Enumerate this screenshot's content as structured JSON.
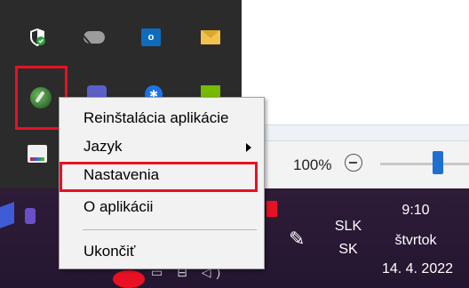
{
  "tray_overflow": {
    "icons": [
      {
        "name": "windows-security-shield-icon",
        "color": "#ffffff"
      },
      {
        "name": "onedrive-offline-cloud-icon",
        "color": "#9c9c9c"
      },
      {
        "name": "outlook-icon",
        "text": "o",
        "color": "#0f6cbd"
      },
      {
        "name": "mail-icon",
        "color": "#f2c14e"
      },
      {
        "name": "app-tray-icon",
        "color": "#3d7a3a"
      },
      {
        "name": "teams-icon",
        "color": "#5b5fc7"
      },
      {
        "name": "bluetooth-icon",
        "color": "#1a73e8"
      },
      {
        "name": "nvidia-icon",
        "color": "#76b900"
      },
      {
        "name": "printer-icon",
        "color": "#f0f0f0"
      }
    ],
    "highlight_color": "#e81123"
  },
  "context_menu": {
    "items": [
      {
        "label": "Reinštalácia aplikácie"
      },
      {
        "label": "Jazyk",
        "has_submenu": true
      },
      {
        "label": "Nastavenia",
        "highlighted": true
      },
      {
        "label": "O aplikácii"
      },
      {
        "label": "Ukončiť"
      }
    ]
  },
  "statusbar": {
    "zoom_label": "100%",
    "zoom_level_percent": 100
  },
  "taskbar": {
    "language_top": "SLK",
    "language_bottom": "SK",
    "time": "9:10",
    "day": "štvrtok",
    "date": "14. 4. 2022"
  }
}
